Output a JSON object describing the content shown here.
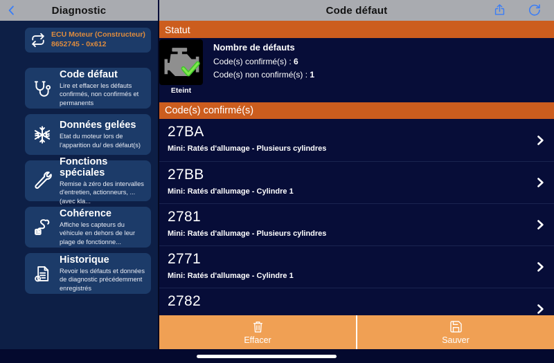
{
  "left_header": {
    "title": "Diagnostic"
  },
  "right_header": {
    "title": "Code défaut"
  },
  "sidebar": {
    "ecu": {
      "line1": "ECU Moteur (Constructeur)",
      "line2": "8652745 - 0x612"
    },
    "items": [
      {
        "icon": "stethoscope-icon",
        "title": "Code défaut",
        "desc": "Lire et effacer les défauts confirmés, non confirmés et permanents"
      },
      {
        "icon": "snowflake-icon",
        "title": "Données gelées",
        "desc": "Etat du moteur lors de l'apparition du/ des défaut(s)"
      },
      {
        "icon": "wrench-icon",
        "title": "Fonctions spéciales",
        "desc": "Remise à zéro des intervalles d'entretien, actionneurs, ... (avec kla..."
      },
      {
        "icon": "sensor-icon",
        "title": "Cohérence",
        "desc": "Affiche les capteurs du véhicule en dehors de leur plage de fonctionne..."
      },
      {
        "icon": "history-icon",
        "title": "Historique",
        "desc": "Revoir les défauts et données de diagnostic précédemment enregistrés"
      }
    ]
  },
  "status": {
    "section_title": "Statut",
    "engine_state": "Eteint",
    "heading": "Nombre de défauts",
    "confirmed_label": "Code(s) confirmé(s) : ",
    "confirmed_count": "6",
    "unconfirmed_label": "Code(s) non confirmé(s) : ",
    "unconfirmed_count": "1"
  },
  "codes": {
    "section_title": "Code(s) confirmé(s)",
    "items": [
      {
        "code": "27BA",
        "desc": "Mini: Ratés d'allumage - Plusieurs cylindres"
      },
      {
        "code": "27BB",
        "desc": "Mini: Ratés d'allumage - Cylindre 1"
      },
      {
        "code": "2781",
        "desc": "Mini: Ratés d'allumage - Plusieurs cylindres"
      },
      {
        "code": "2771",
        "desc": "Mini: Ratés d'allumage - Cylindre 1"
      },
      {
        "code": "2782",
        "desc": ""
      }
    ]
  },
  "actions": {
    "clear": "Effacer",
    "save": "Sauver"
  },
  "colors": {
    "header_gray": "#A9ABB0",
    "accent_blue": "#3A7DF6",
    "section_orange": "#CC5D1E",
    "action_bar_orange": "#F0A054",
    "sidebar_navy": "#0D1F46",
    "card_navy": "#1C3B69",
    "main_navy": "#070D38",
    "ecu_text_orange": "#DF8C3E",
    "check_green": "#3FC52C"
  }
}
